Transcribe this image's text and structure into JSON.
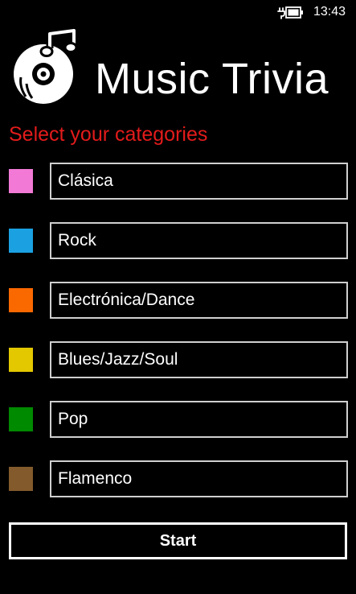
{
  "status_bar": {
    "time": "13:43",
    "battery_icon": "battery-charging-icon"
  },
  "header": {
    "logo_icon": "music-disc-icon",
    "title": "Music Trivia"
  },
  "subtitle": "Select your categories",
  "categories": [
    {
      "label": "Clásica",
      "color": "#f27ad6"
    },
    {
      "label": "Rock",
      "color": "#1ba1e2"
    },
    {
      "label": "Electrónica/Dance",
      "color": "#fa6800"
    },
    {
      "label": "Blues/Jazz/Soul",
      "color": "#e3c800"
    },
    {
      "label": "Pop",
      "color": "#008a00"
    },
    {
      "label": "Flamenco",
      "color": "#825a2c"
    }
  ],
  "start_button": {
    "label": "Start"
  },
  "colors": {
    "accent": "#e31b1b",
    "background": "#000000",
    "foreground": "#ffffff"
  }
}
